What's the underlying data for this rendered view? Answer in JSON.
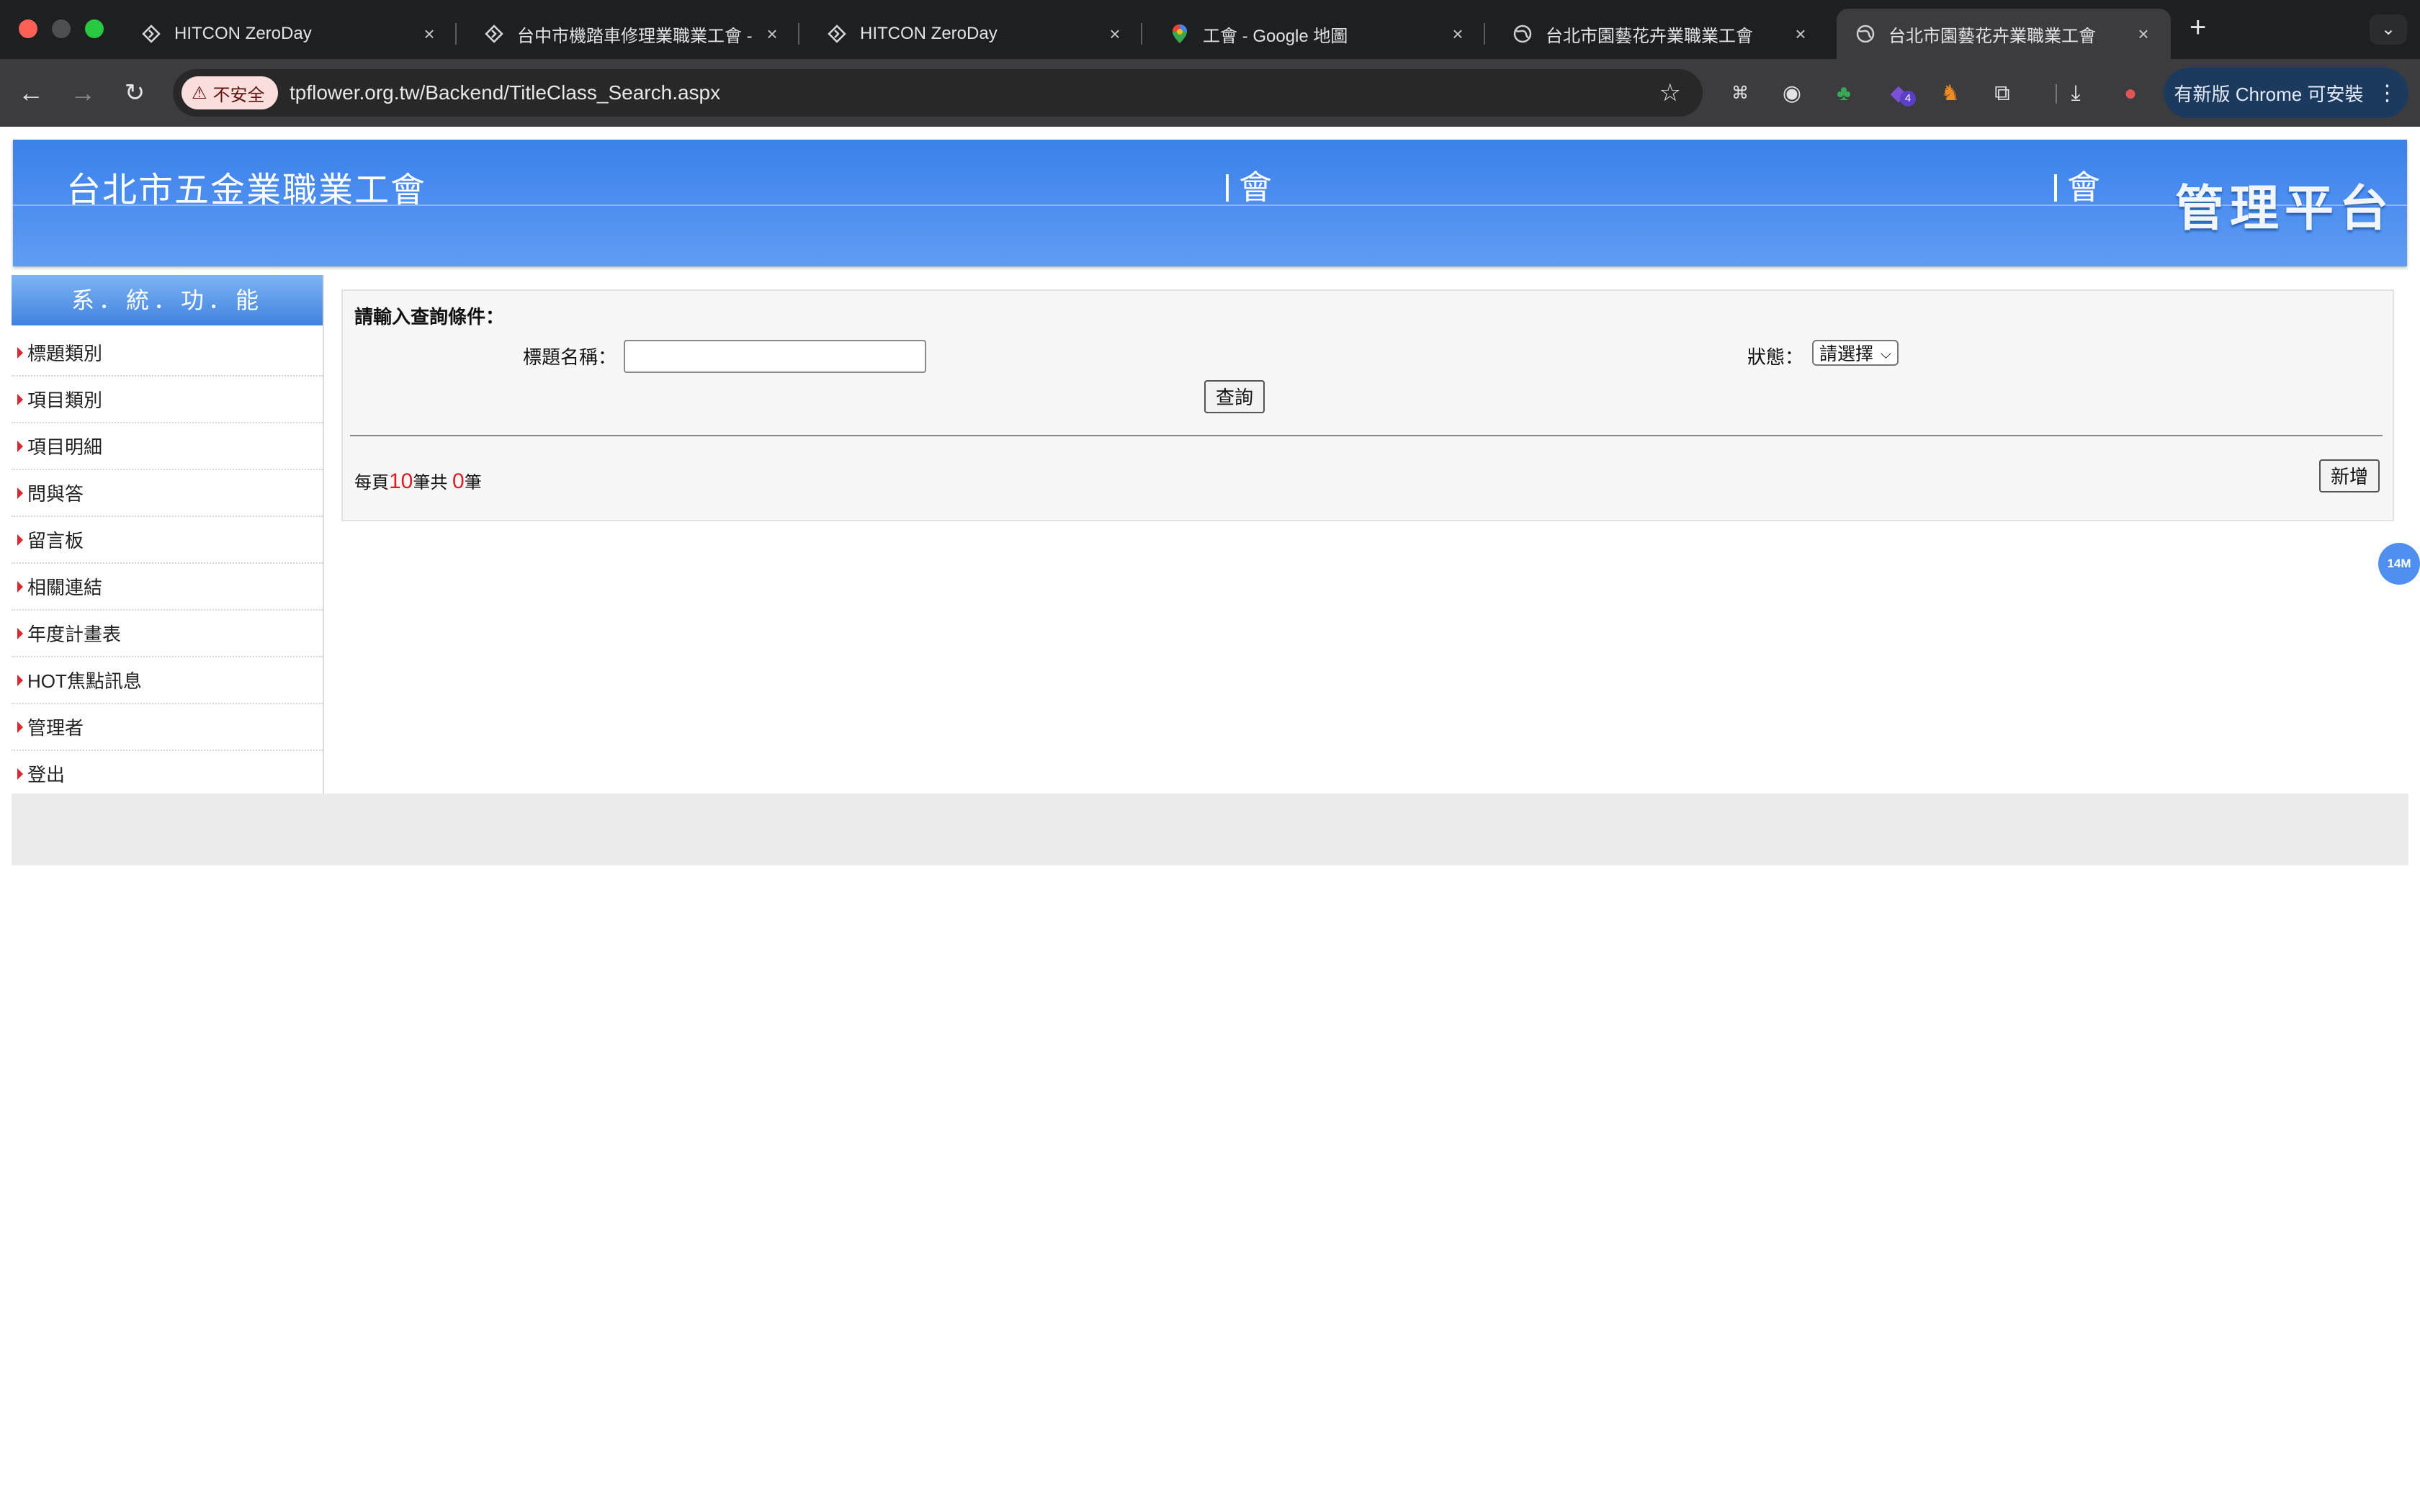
{
  "browser": {
    "tabs": [
      {
        "title": "HITCON ZeroDay",
        "icon": "hitcon-icon"
      },
      {
        "title": "台中市機踏車修理業職業工會 -",
        "icon": "hitcon-icon"
      },
      {
        "title": "HITCON ZeroDay",
        "icon": "hitcon-icon"
      },
      {
        "title": "工會 - Google 地圖",
        "icon": "maps-pin-icon"
      },
      {
        "title": "台北市園藝花卉業職業工會",
        "icon": "globe-icon"
      },
      {
        "title": "台北市園藝花卉業職業工會",
        "icon": "globe-icon"
      }
    ],
    "security_label": "不安全",
    "url": "tpflower.org.tw/Backend/TitleClass_Search.aspx",
    "extension_badge": "4",
    "update_label": "有新版 Chrome 可安裝"
  },
  "header": {
    "site_title": "台北市五金業職業工會",
    "fragment_mid": "會",
    "fragment_right": "會",
    "admin_title": "管理平台"
  },
  "sidebar": {
    "heading": "系．統．功．能",
    "items": [
      {
        "label": "標題類別"
      },
      {
        "label": "項目類別"
      },
      {
        "label": "項目明細"
      },
      {
        "label": "問與答"
      },
      {
        "label": "留言板"
      },
      {
        "label": "相關連結"
      },
      {
        "label": "年度計畫表"
      },
      {
        "label": "HOT焦點訊息"
      },
      {
        "label": "管理者"
      },
      {
        "label": "登出"
      }
    ]
  },
  "search": {
    "prompt": "請輸入查詢條件：",
    "title_label": "標題名稱：",
    "title_value": "",
    "status_label": "狀態：",
    "status_selected": "請選擇",
    "query_button": "查詢"
  },
  "results": {
    "per_page_prefix": "每頁",
    "per_page": "10",
    "total_prefix": "筆共",
    "total": "0",
    "total_suffix": "筆",
    "add_button": "新增"
  },
  "float_badge": "14M"
}
